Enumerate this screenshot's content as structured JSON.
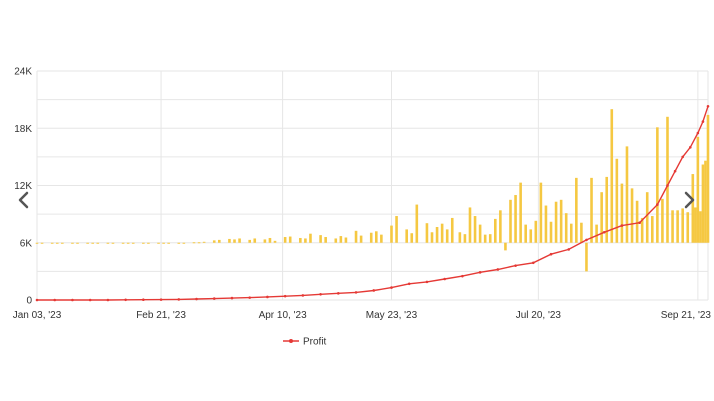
{
  "chart_data": {
    "type": "bar+line",
    "ylim": [
      0,
      24000
    ],
    "y_ticks": [
      {
        "value": 0,
        "label": "0"
      },
      {
        "value": 6000,
        "label": "6K"
      },
      {
        "value": 12000,
        "label": "12K"
      },
      {
        "value": 18000,
        "label": "18K"
      },
      {
        "value": 24000,
        "label": "24K"
      }
    ],
    "x_range": [
      "2023-01-03",
      "2023-09-25"
    ],
    "x_ticks": [
      {
        "date": "2023-01-03",
        "label": "Jan 03, '23"
      },
      {
        "date": "2023-02-21",
        "label": "Feb 21, '23"
      },
      {
        "date": "2023-04-10",
        "label": "Apr 10, '23"
      },
      {
        "date": "2023-05-23",
        "label": "May 23, '23"
      },
      {
        "date": "2023-07-20",
        "label": "Jul 20, '23"
      },
      {
        "date": "2023-09-21",
        "label": "Sep 21, '23"
      }
    ],
    "bar_baseline": 6000,
    "bar_color": "#f5c842",
    "line_color": "#e53935",
    "bars": [
      {
        "date": "2023-01-03",
        "value": 6000
      },
      {
        "date": "2023-01-05",
        "value": 6000
      },
      {
        "date": "2023-01-09",
        "value": 6000
      },
      {
        "date": "2023-01-11",
        "value": 6000
      },
      {
        "date": "2023-01-13",
        "value": 6000
      },
      {
        "date": "2023-01-17",
        "value": 6000
      },
      {
        "date": "2023-01-19",
        "value": 6000
      },
      {
        "date": "2023-01-23",
        "value": 6000
      },
      {
        "date": "2023-01-25",
        "value": 6000
      },
      {
        "date": "2023-01-27",
        "value": 6000
      },
      {
        "date": "2023-01-31",
        "value": 6000
      },
      {
        "date": "2023-02-02",
        "value": 6000
      },
      {
        "date": "2023-02-06",
        "value": 6000
      },
      {
        "date": "2023-02-08",
        "value": 6000
      },
      {
        "date": "2023-02-10",
        "value": 6000
      },
      {
        "date": "2023-02-14",
        "value": 6000
      },
      {
        "date": "2023-02-16",
        "value": 6000
      },
      {
        "date": "2023-02-20",
        "value": 6000
      },
      {
        "date": "2023-02-22",
        "value": 6000
      },
      {
        "date": "2023-02-24",
        "value": 6000
      },
      {
        "date": "2023-02-28",
        "value": 6000
      },
      {
        "date": "2023-03-02",
        "value": 6000
      },
      {
        "date": "2023-03-06",
        "value": 6050
      },
      {
        "date": "2023-03-08",
        "value": 6050
      },
      {
        "date": "2023-03-10",
        "value": 6100
      },
      {
        "date": "2023-03-14",
        "value": 6250
      },
      {
        "date": "2023-03-16",
        "value": 6300
      },
      {
        "date": "2023-03-20",
        "value": 6400
      },
      {
        "date": "2023-03-22",
        "value": 6350
      },
      {
        "date": "2023-03-24",
        "value": 6450
      },
      {
        "date": "2023-03-28",
        "value": 6300
      },
      {
        "date": "2023-03-30",
        "value": 6450
      },
      {
        "date": "2023-04-03",
        "value": 6350
      },
      {
        "date": "2023-04-05",
        "value": 6500
      },
      {
        "date": "2023-04-07",
        "value": 6200
      },
      {
        "date": "2023-04-11",
        "value": 6600
      },
      {
        "date": "2023-04-13",
        "value": 6650
      },
      {
        "date": "2023-04-17",
        "value": 6500
      },
      {
        "date": "2023-04-19",
        "value": 6450
      },
      {
        "date": "2023-04-21",
        "value": 6950
      },
      {
        "date": "2023-04-25",
        "value": 6800
      },
      {
        "date": "2023-04-27",
        "value": 6600
      },
      {
        "date": "2023-05-01",
        "value": 6450
      },
      {
        "date": "2023-05-03",
        "value": 6700
      },
      {
        "date": "2023-05-05",
        "value": 6550
      },
      {
        "date": "2023-05-09",
        "value": 7250
      },
      {
        "date": "2023-05-11",
        "value": 6750
      },
      {
        "date": "2023-05-15",
        "value": 7050
      },
      {
        "date": "2023-05-17",
        "value": 7200
      },
      {
        "date": "2023-05-19",
        "value": 6850
      },
      {
        "date": "2023-05-23",
        "value": 7800
      },
      {
        "date": "2023-05-25",
        "value": 8800
      },
      {
        "date": "2023-05-29",
        "value": 7400
      },
      {
        "date": "2023-05-31",
        "value": 7000
      },
      {
        "date": "2023-06-02",
        "value": 10000
      },
      {
        "date": "2023-06-06",
        "value": 8050
      },
      {
        "date": "2023-06-08",
        "value": 7100
      },
      {
        "date": "2023-06-10",
        "value": 7650
      },
      {
        "date": "2023-06-12",
        "value": 8000
      },
      {
        "date": "2023-06-14",
        "value": 7400
      },
      {
        "date": "2023-06-16",
        "value": 8600
      },
      {
        "date": "2023-06-19",
        "value": 7100
      },
      {
        "date": "2023-06-21",
        "value": 6900
      },
      {
        "date": "2023-06-23",
        "value": 9700
      },
      {
        "date": "2023-06-25",
        "value": 8800
      },
      {
        "date": "2023-06-27",
        "value": 7900
      },
      {
        "date": "2023-06-29",
        "value": 6850
      },
      {
        "date": "2023-07-01",
        "value": 6900
      },
      {
        "date": "2023-07-03",
        "value": 8500
      },
      {
        "date": "2023-07-05",
        "value": 9400
      },
      {
        "date": "2023-07-07",
        "value": 5200
      },
      {
        "date": "2023-07-09",
        "value": 10500
      },
      {
        "date": "2023-07-11",
        "value": 11000
      },
      {
        "date": "2023-07-13",
        "value": 12300
      },
      {
        "date": "2023-07-15",
        "value": 7900
      },
      {
        "date": "2023-07-17",
        "value": 7400
      },
      {
        "date": "2023-07-19",
        "value": 8300
      },
      {
        "date": "2023-07-21",
        "value": 12300
      },
      {
        "date": "2023-07-23",
        "value": 9900
      },
      {
        "date": "2023-07-25",
        "value": 8200
      },
      {
        "date": "2023-07-27",
        "value": 10300
      },
      {
        "date": "2023-07-29",
        "value": 10500
      },
      {
        "date": "2023-07-31",
        "value": 9100
      },
      {
        "date": "2023-08-02",
        "value": 8000
      },
      {
        "date": "2023-08-04",
        "value": 12800
      },
      {
        "date": "2023-08-06",
        "value": 8100
      },
      {
        "date": "2023-08-08",
        "value": 3000
      },
      {
        "date": "2023-08-10",
        "value": 12800
      },
      {
        "date": "2023-08-12",
        "value": 7900
      },
      {
        "date": "2023-08-14",
        "value": 11300
      },
      {
        "date": "2023-08-16",
        "value": 12900
      },
      {
        "date": "2023-08-18",
        "value": 20000
      },
      {
        "date": "2023-08-20",
        "value": 14800
      },
      {
        "date": "2023-08-22",
        "value": 12200
      },
      {
        "date": "2023-08-24",
        "value": 16100
      },
      {
        "date": "2023-08-26",
        "value": 11700
      },
      {
        "date": "2023-08-28",
        "value": 10400
      },
      {
        "date": "2023-08-30",
        "value": 8600
      },
      {
        "date": "2023-09-01",
        "value": 11300
      },
      {
        "date": "2023-09-03",
        "value": 8800
      },
      {
        "date": "2023-09-05",
        "value": 18100
      },
      {
        "date": "2023-09-07",
        "value": 10600
      },
      {
        "date": "2023-09-09",
        "value": 19200
      },
      {
        "date": "2023-09-11",
        "value": 9400
      },
      {
        "date": "2023-09-13",
        "value": 9400
      },
      {
        "date": "2023-09-15",
        "value": 9600
      },
      {
        "date": "2023-09-17",
        "value": 9200
      },
      {
        "date": "2023-09-19",
        "value": 13200
      },
      {
        "date": "2023-09-20",
        "value": 9700
      },
      {
        "date": "2023-09-21",
        "value": 17100
      },
      {
        "date": "2023-09-22",
        "value": 9300
      },
      {
        "date": "2023-09-23",
        "value": 14200
      },
      {
        "date": "2023-09-24",
        "value": 14600
      },
      {
        "date": "2023-09-25",
        "value": 19400
      }
    ],
    "series": [
      {
        "name": "Profit",
        "points": [
          {
            "date": "2023-01-03",
            "value": 0
          },
          {
            "date": "2023-01-10",
            "value": 0
          },
          {
            "date": "2023-01-17",
            "value": 0
          },
          {
            "date": "2023-01-24",
            "value": 0
          },
          {
            "date": "2023-01-31",
            "value": 0
          },
          {
            "date": "2023-02-07",
            "value": 20
          },
          {
            "date": "2023-02-14",
            "value": 30
          },
          {
            "date": "2023-02-21",
            "value": 40
          },
          {
            "date": "2023-02-28",
            "value": 60
          },
          {
            "date": "2023-03-07",
            "value": 100
          },
          {
            "date": "2023-03-14",
            "value": 150
          },
          {
            "date": "2023-03-21",
            "value": 200
          },
          {
            "date": "2023-03-28",
            "value": 250
          },
          {
            "date": "2023-04-04",
            "value": 320
          },
          {
            "date": "2023-04-11",
            "value": 400
          },
          {
            "date": "2023-04-18",
            "value": 480
          },
          {
            "date": "2023-04-25",
            "value": 600
          },
          {
            "date": "2023-05-02",
            "value": 700
          },
          {
            "date": "2023-05-09",
            "value": 800
          },
          {
            "date": "2023-05-16",
            "value": 1000
          },
          {
            "date": "2023-05-23",
            "value": 1300
          },
          {
            "date": "2023-05-30",
            "value": 1700
          },
          {
            "date": "2023-06-06",
            "value": 1900
          },
          {
            "date": "2023-06-13",
            "value": 2200
          },
          {
            "date": "2023-06-20",
            "value": 2500
          },
          {
            "date": "2023-06-27",
            "value": 2900
          },
          {
            "date": "2023-07-04",
            "value": 3200
          },
          {
            "date": "2023-07-11",
            "value": 3600
          },
          {
            "date": "2023-07-18",
            "value": 3900
          },
          {
            "date": "2023-07-25",
            "value": 4800
          },
          {
            "date": "2023-08-01",
            "value": 5300
          },
          {
            "date": "2023-08-08",
            "value": 6300
          },
          {
            "date": "2023-08-15",
            "value": 7100
          },
          {
            "date": "2023-08-22",
            "value": 7800
          },
          {
            "date": "2023-08-29",
            "value": 8100
          },
          {
            "date": "2023-09-05",
            "value": 10000
          },
          {
            "date": "2023-09-09",
            "value": 12000
          },
          {
            "date": "2023-09-12",
            "value": 13500
          },
          {
            "date": "2023-09-15",
            "value": 15000
          },
          {
            "date": "2023-09-18",
            "value": 16000
          },
          {
            "date": "2023-09-21",
            "value": 17500
          },
          {
            "date": "2023-09-23",
            "value": 18700
          },
          {
            "date": "2023-09-25",
            "value": 20300
          }
        ]
      }
    ],
    "legend": {
      "position": "bottom-left",
      "label": "Profit"
    },
    "grid": true
  },
  "navigation": {
    "prev_icon": "chevron-left-icon",
    "next_icon": "chevron-right-icon",
    "icon_color": "#555555"
  },
  "colors": {
    "grid": "#e6e6e6",
    "axis_text": "#333333"
  }
}
